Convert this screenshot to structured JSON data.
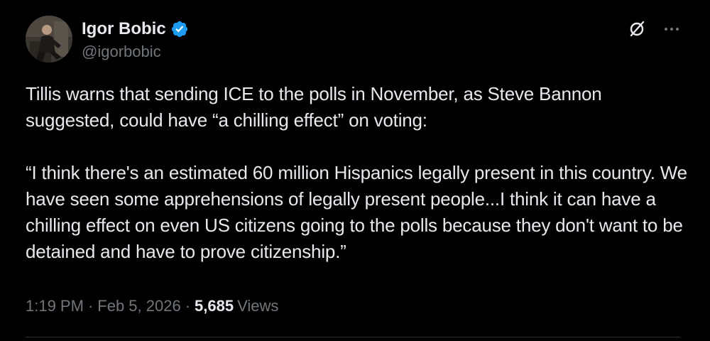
{
  "author": {
    "display_name": "Igor Bobic",
    "handle": "@igorbobic",
    "verified": true,
    "verified_color": "#1d9bf0"
  },
  "header_actions": {
    "grok_icon": "grok-slash-circle-icon",
    "more_icon": "more-horizontal-icon"
  },
  "tweet": {
    "paragraph_1": "Tillis warns that sending ICE to the polls in November, as Steve Bannon suggested, could have “a chilling effect” on voting:",
    "paragraph_2": "“I think there's an estimated 60 million Hispanics legally present in this country. We have seen some apprehensions of legally present people...I think it can have a chilling effect on even US citizens going to the polls because they don't want to be detained and have to prove citizenship.”"
  },
  "meta": {
    "time": "1:19 PM",
    "separator": "·",
    "date": "Feb 5, 2026",
    "views_count": "5,685",
    "views_label": "Views"
  },
  "colors": {
    "background": "#000000",
    "primary_text": "#e7e9ea",
    "secondary_text": "#71767b",
    "divider": "#2f3336"
  }
}
